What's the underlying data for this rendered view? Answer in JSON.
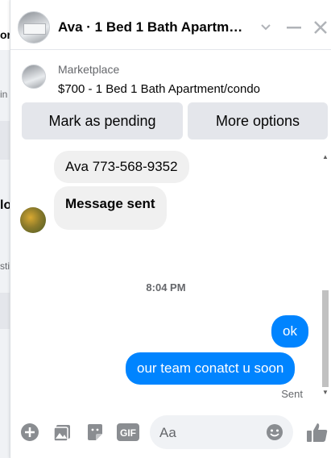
{
  "background": {
    "fragments": [
      "or",
      "in",
      "lo",
      "sti"
    ]
  },
  "header": {
    "title": "Ava · 1 Bed 1 Bath Apartm…"
  },
  "listing": {
    "kicker": "Marketplace",
    "summary": "$700 - 1 Bed 1 Bath Apartment/condo",
    "actions": {
      "primary": "Mark as pending",
      "secondary": "More options"
    }
  },
  "messages": {
    "incoming": [
      "Ava 773-568-9352",
      "Message sent"
    ],
    "timestamp": "8:04 PM",
    "outgoing": [
      "ok",
      "our team conatct u soon"
    ],
    "status": "Sent"
  },
  "composer": {
    "placeholder": "Aa",
    "gif_label": "GIF"
  },
  "colors": {
    "accent": "#0084ff",
    "incoming_bubble": "#f0f0f0",
    "button_bg": "#e4e6eb"
  }
}
